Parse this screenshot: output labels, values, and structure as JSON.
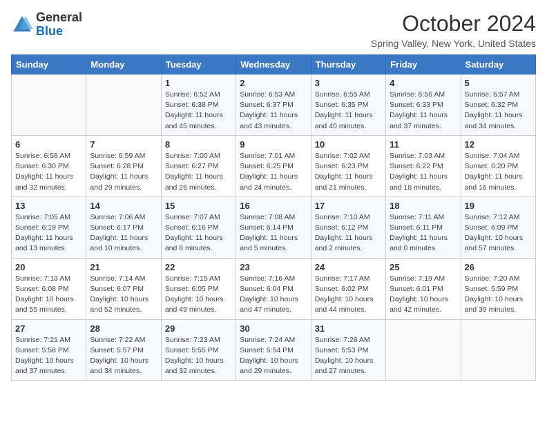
{
  "header": {
    "logo_general": "General",
    "logo_blue": "Blue",
    "month_title": "October 2024",
    "location": "Spring Valley, New York, United States"
  },
  "weekdays": [
    "Sunday",
    "Monday",
    "Tuesday",
    "Wednesday",
    "Thursday",
    "Friday",
    "Saturday"
  ],
  "weeks": [
    [
      {
        "day": "",
        "sunrise": "",
        "sunset": "",
        "daylight": ""
      },
      {
        "day": "",
        "sunrise": "",
        "sunset": "",
        "daylight": ""
      },
      {
        "day": "1",
        "sunrise": "Sunrise: 6:52 AM",
        "sunset": "Sunset: 6:38 PM",
        "daylight": "Daylight: 11 hours and 45 minutes."
      },
      {
        "day": "2",
        "sunrise": "Sunrise: 6:53 AM",
        "sunset": "Sunset: 6:37 PM",
        "daylight": "Daylight: 11 hours and 43 minutes."
      },
      {
        "day": "3",
        "sunrise": "Sunrise: 6:55 AM",
        "sunset": "Sunset: 6:35 PM",
        "daylight": "Daylight: 11 hours and 40 minutes."
      },
      {
        "day": "4",
        "sunrise": "Sunrise: 6:56 AM",
        "sunset": "Sunset: 6:33 PM",
        "daylight": "Daylight: 11 hours and 37 minutes."
      },
      {
        "day": "5",
        "sunrise": "Sunrise: 6:57 AM",
        "sunset": "Sunset: 6:32 PM",
        "daylight": "Daylight: 11 hours and 34 minutes."
      }
    ],
    [
      {
        "day": "6",
        "sunrise": "Sunrise: 6:58 AM",
        "sunset": "Sunset: 6:30 PM",
        "daylight": "Daylight: 11 hours and 32 minutes."
      },
      {
        "day": "7",
        "sunrise": "Sunrise: 6:59 AM",
        "sunset": "Sunset: 6:28 PM",
        "daylight": "Daylight: 11 hours and 29 minutes."
      },
      {
        "day": "8",
        "sunrise": "Sunrise: 7:00 AM",
        "sunset": "Sunset: 6:27 PM",
        "daylight": "Daylight: 11 hours and 26 minutes."
      },
      {
        "day": "9",
        "sunrise": "Sunrise: 7:01 AM",
        "sunset": "Sunset: 6:25 PM",
        "daylight": "Daylight: 11 hours and 24 minutes."
      },
      {
        "day": "10",
        "sunrise": "Sunrise: 7:02 AM",
        "sunset": "Sunset: 6:23 PM",
        "daylight": "Daylight: 11 hours and 21 minutes."
      },
      {
        "day": "11",
        "sunrise": "Sunrise: 7:03 AM",
        "sunset": "Sunset: 6:22 PM",
        "daylight": "Daylight: 11 hours and 18 minutes."
      },
      {
        "day": "12",
        "sunrise": "Sunrise: 7:04 AM",
        "sunset": "Sunset: 6:20 PM",
        "daylight": "Daylight: 11 hours and 16 minutes."
      }
    ],
    [
      {
        "day": "13",
        "sunrise": "Sunrise: 7:05 AM",
        "sunset": "Sunset: 6:19 PM",
        "daylight": "Daylight: 11 hours and 13 minutes."
      },
      {
        "day": "14",
        "sunrise": "Sunrise: 7:06 AM",
        "sunset": "Sunset: 6:17 PM",
        "daylight": "Daylight: 11 hours and 10 minutes."
      },
      {
        "day": "15",
        "sunrise": "Sunrise: 7:07 AM",
        "sunset": "Sunset: 6:16 PM",
        "daylight": "Daylight: 11 hours and 8 minutes."
      },
      {
        "day": "16",
        "sunrise": "Sunrise: 7:08 AM",
        "sunset": "Sunset: 6:14 PM",
        "daylight": "Daylight: 11 hours and 5 minutes."
      },
      {
        "day": "17",
        "sunrise": "Sunrise: 7:10 AM",
        "sunset": "Sunset: 6:12 PM",
        "daylight": "Daylight: 11 hours and 2 minutes."
      },
      {
        "day": "18",
        "sunrise": "Sunrise: 7:11 AM",
        "sunset": "Sunset: 6:11 PM",
        "daylight": "Daylight: 11 hours and 0 minutes."
      },
      {
        "day": "19",
        "sunrise": "Sunrise: 7:12 AM",
        "sunset": "Sunset: 6:09 PM",
        "daylight": "Daylight: 10 hours and 57 minutes."
      }
    ],
    [
      {
        "day": "20",
        "sunrise": "Sunrise: 7:13 AM",
        "sunset": "Sunset: 6:08 PM",
        "daylight": "Daylight: 10 hours and 55 minutes."
      },
      {
        "day": "21",
        "sunrise": "Sunrise: 7:14 AM",
        "sunset": "Sunset: 6:07 PM",
        "daylight": "Daylight: 10 hours and 52 minutes."
      },
      {
        "day": "22",
        "sunrise": "Sunrise: 7:15 AM",
        "sunset": "Sunset: 6:05 PM",
        "daylight": "Daylight: 10 hours and 49 minutes."
      },
      {
        "day": "23",
        "sunrise": "Sunrise: 7:16 AM",
        "sunset": "Sunset: 6:04 PM",
        "daylight": "Daylight: 10 hours and 47 minutes."
      },
      {
        "day": "24",
        "sunrise": "Sunrise: 7:17 AM",
        "sunset": "Sunset: 6:02 PM",
        "daylight": "Daylight: 10 hours and 44 minutes."
      },
      {
        "day": "25",
        "sunrise": "Sunrise: 7:19 AM",
        "sunset": "Sunset: 6:01 PM",
        "daylight": "Daylight: 10 hours and 42 minutes."
      },
      {
        "day": "26",
        "sunrise": "Sunrise: 7:20 AM",
        "sunset": "Sunset: 5:59 PM",
        "daylight": "Daylight: 10 hours and 39 minutes."
      }
    ],
    [
      {
        "day": "27",
        "sunrise": "Sunrise: 7:21 AM",
        "sunset": "Sunset: 5:58 PM",
        "daylight": "Daylight: 10 hours and 37 minutes."
      },
      {
        "day": "28",
        "sunrise": "Sunrise: 7:22 AM",
        "sunset": "Sunset: 5:57 PM",
        "daylight": "Daylight: 10 hours and 34 minutes."
      },
      {
        "day": "29",
        "sunrise": "Sunrise: 7:23 AM",
        "sunset": "Sunset: 5:55 PM",
        "daylight": "Daylight: 10 hours and 32 minutes."
      },
      {
        "day": "30",
        "sunrise": "Sunrise: 7:24 AM",
        "sunset": "Sunset: 5:54 PM",
        "daylight": "Daylight: 10 hours and 29 minutes."
      },
      {
        "day": "31",
        "sunrise": "Sunrise: 7:26 AM",
        "sunset": "Sunset: 5:53 PM",
        "daylight": "Daylight: 10 hours and 27 minutes."
      },
      {
        "day": "",
        "sunrise": "",
        "sunset": "",
        "daylight": ""
      },
      {
        "day": "",
        "sunrise": "",
        "sunset": "",
        "daylight": ""
      }
    ]
  ]
}
